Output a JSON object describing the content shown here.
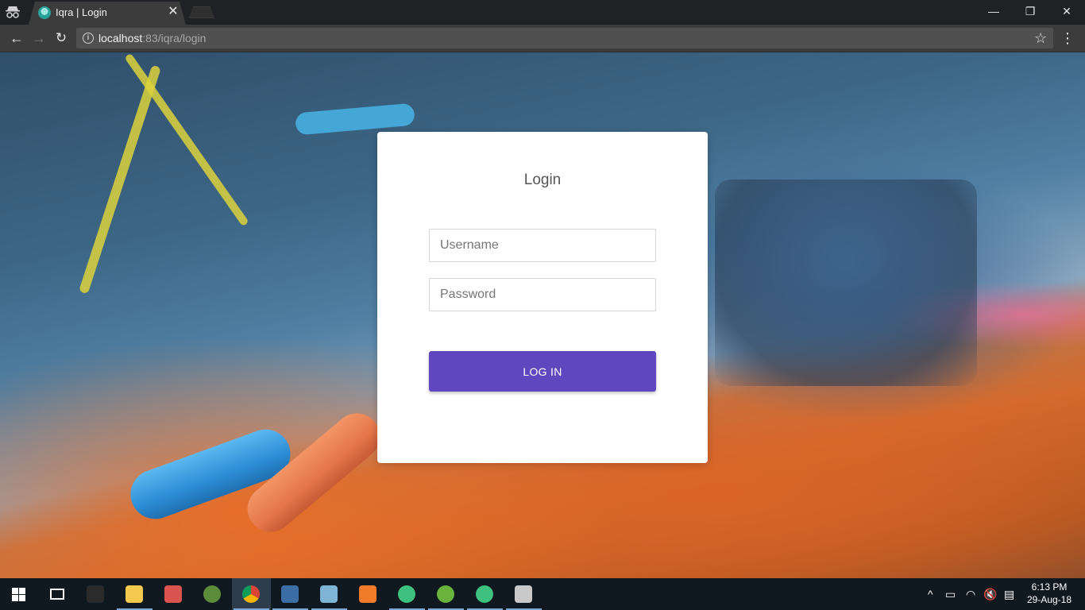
{
  "browser": {
    "tab": {
      "title": "Iqra | Login",
      "close": "✕"
    },
    "window_controls": {
      "minimize": "—",
      "maximize": "❐",
      "close": "✕"
    },
    "toolbar": {
      "back": "←",
      "forward": "→",
      "reload": "↻",
      "star": "☆",
      "menu": "⋮",
      "info": "i"
    },
    "address": {
      "host": "localhost",
      "rest": ":83/iqra/login"
    }
  },
  "login": {
    "title": "Login",
    "username_placeholder": "Username",
    "password_placeholder": "Password",
    "submit_label": "LOG IN"
  },
  "taskbar": {
    "apps": [
      {
        "name": "terminal-icon",
        "color": "#2b2b2b"
      },
      {
        "name": "file-explorer-icon",
        "color": "#f2c94c"
      },
      {
        "name": "paint-icon",
        "color": "#d9534f"
      },
      {
        "name": "globe-icon",
        "color": "#5b8c3a"
      },
      {
        "name": "chrome-icon",
        "color": "#db4437"
      },
      {
        "name": "virtualbox-icon",
        "color": "#3b6ea5"
      },
      {
        "name": "notepad-icon",
        "color": "#7fb4d6"
      },
      {
        "name": "xampp-icon",
        "color": "#f07c2a"
      },
      {
        "name": "atom-icon",
        "color": "#3ec17f"
      },
      {
        "name": "utorrent-icon",
        "color": "#6ab33d"
      },
      {
        "name": "atom-icon-2",
        "color": "#3ec17f"
      },
      {
        "name": "palette-icon",
        "color": "#c9c9c9"
      }
    ],
    "tray": {
      "chevron": "^",
      "battery": "▭",
      "wifi": "◠",
      "volume": "🔇",
      "notifications": "▤"
    },
    "clock": {
      "time": "6:13 PM",
      "date": "29-Aug-18"
    }
  }
}
